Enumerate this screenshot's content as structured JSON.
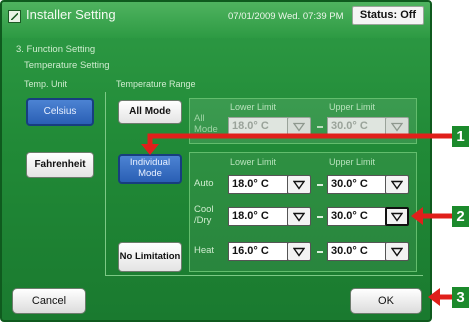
{
  "header": {
    "title": "Installer Setting",
    "datetime": "07/01/2009 Wed. 07:39 PM",
    "status_button": "Status: Off"
  },
  "breadcrumb": {
    "section": "3. Function Setting",
    "page": "Temperature Setting"
  },
  "temp_unit": {
    "label": "Temp. Unit",
    "celsius": "Celsius",
    "fahrenheit": "Fahrenheit",
    "selected": "Celsius"
  },
  "temp_range": {
    "label": "Temperature Range",
    "all_mode_button": "All Mode",
    "individual_mode_button": "Individual Mode",
    "no_limitation_button": "No Limitation",
    "selected": "Individual Mode",
    "lower_limit_header": "Lower Limit",
    "upper_limit_header": "Upper Limit",
    "rows": [
      {
        "label": "All Mode",
        "lower": "18.0° C",
        "upper": "30.0° C",
        "enabled": false
      },
      {
        "label": "Auto",
        "lower": "18.0° C",
        "upper": "30.0° C",
        "enabled": true
      },
      {
        "label": "Cool /Dry",
        "lower": "18.0° C",
        "upper": "30.0° C",
        "enabled": true
      },
      {
        "label": "Heat",
        "lower": "16.0° C",
        "upper": "30.0° C",
        "enabled": true
      }
    ]
  },
  "footer": {
    "cancel": "Cancel",
    "ok": "OK"
  },
  "callouts": [
    "1",
    "2",
    "3"
  ],
  "colors": {
    "screen_green": "#218a37",
    "selected_blue": "#2a5fb4",
    "callout_green": "#1c8a2c",
    "arrow_red": "#e0201b"
  },
  "icons": {
    "app": "window-icon",
    "dropdown": "triangle-down-icon"
  }
}
